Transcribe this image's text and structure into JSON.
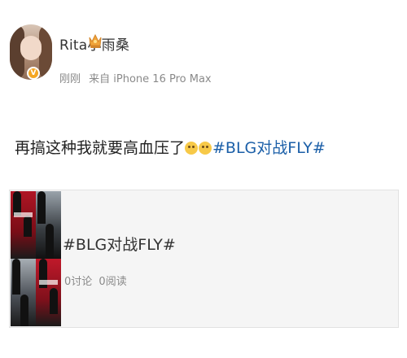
{
  "post": {
    "author": {
      "name": "Rita小雨桑",
      "verified_badge": "V",
      "crown_icon": "crown-icon"
    },
    "meta": {
      "time": "刚刚",
      "source": "来自 iPhone 16 Pro Max"
    },
    "content": {
      "text": "再搞这种我就要高血压了",
      "emoji_count": 2,
      "hashtag": "#BLG对战FLY#"
    },
    "topic_card": {
      "title": "#BLG对战FLY#",
      "discussions": "0讨论",
      "reads": "0阅读"
    }
  },
  "colors": {
    "link": "#1b5fa8",
    "meta_text": "#8a8a8a",
    "card_background": "#f5f5f5",
    "badge": "#f5a623"
  }
}
